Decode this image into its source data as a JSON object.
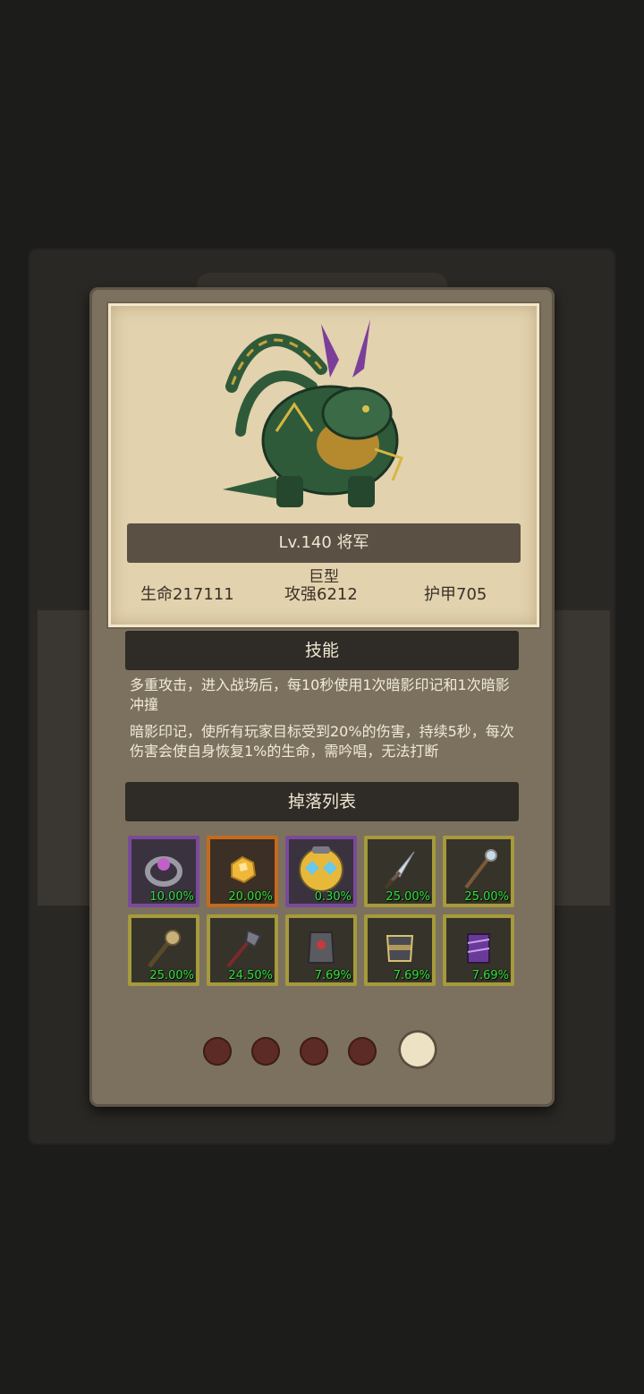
{
  "monster": {
    "level_title": "Lv.140 将军",
    "size": "巨型",
    "hp": "生命217111",
    "attack": "攻强6212",
    "armor": "护甲705"
  },
  "skills": {
    "title": "技能",
    "lines": [
      "多重攻击，进入战场后，每10秒使用1次暗影印记和1次暗影冲撞",
      "暗影印记，使所有玩家目标受到20%的伤害，持续5秒，每次伤害会使自身恢复1%的生命，需吟唱，无法打断"
    ]
  },
  "drops": {
    "title": "掉落列表",
    "items": [
      {
        "icon": "ring-icon",
        "rarity": "purple",
        "chance": "10.00%"
      },
      {
        "icon": "gold-ore-icon",
        "rarity": "orange",
        "chance": "20.00%"
      },
      {
        "icon": "helmet-icon",
        "rarity": "purple",
        "chance": "0.30%"
      },
      {
        "icon": "dagger-icon",
        "rarity": "gold",
        "chance": "25.00%"
      },
      {
        "icon": "staff-icon",
        "rarity": "gold",
        "chance": "25.00%"
      },
      {
        "icon": "mace-icon",
        "rarity": "gold",
        "chance": "25.00%"
      },
      {
        "icon": "axe-icon",
        "rarity": "gold",
        "chance": "24.50%"
      },
      {
        "icon": "armor-icon",
        "rarity": "gold",
        "chance": "7.69%"
      },
      {
        "icon": "belt-icon",
        "rarity": "gold",
        "chance": "7.69%"
      },
      {
        "icon": "bracer-icon",
        "rarity": "gold",
        "chance": "7.69%"
      }
    ]
  },
  "pager": {
    "count": 5,
    "active_index": 4
  },
  "colors": {
    "purple_rarity": "#7a4a9a",
    "orange_rarity": "#c46a1e",
    "gold_rarity": "#a59a3c",
    "drop_chance_text": "#2fe23a"
  }
}
